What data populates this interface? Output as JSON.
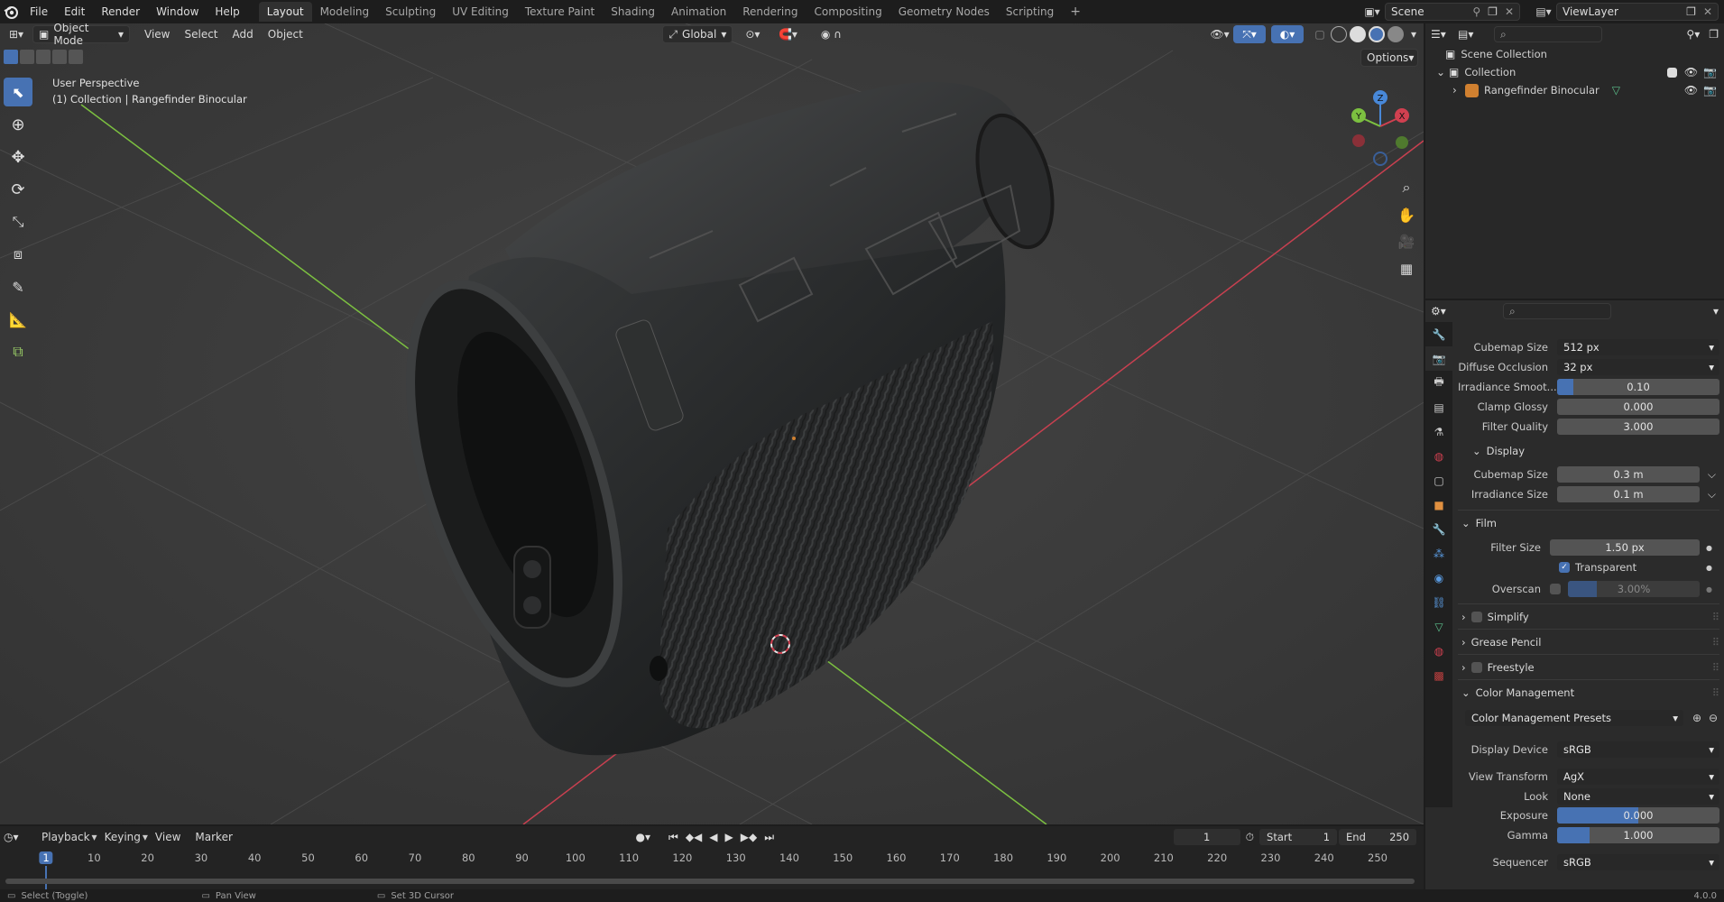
{
  "menu": {
    "items": [
      "File",
      "Edit",
      "Render",
      "Window",
      "Help"
    ]
  },
  "workspaces": [
    "Layout",
    "Modeling",
    "Sculpting",
    "UV Editing",
    "Texture Paint",
    "Shading",
    "Animation",
    "Rendering",
    "Compositing",
    "Geometry Nodes",
    "Scripting"
  ],
  "scene": {
    "name": "Scene",
    "view_layer": "ViewLayer"
  },
  "viewport": {
    "mode": "Object Mode",
    "menus": [
      "View",
      "Select",
      "Add",
      "Object"
    ],
    "transform_orientation": "Global",
    "options_label": "Options",
    "perspective_label": "User Perspective",
    "collection_label": "(1) Collection | Rangefinder Binocular",
    "gizmo_axes": {
      "x": "X",
      "y": "Y",
      "z": "Z"
    }
  },
  "outliner": {
    "root": "Scene Collection",
    "collection": "Collection",
    "object": "Rangefinder Binocular"
  },
  "properties": {
    "rows_top": [
      {
        "label": "Cubemap Size",
        "value": "512 px",
        "type": "dropdown"
      },
      {
        "label": "Diffuse Occlusion",
        "value": "32 px",
        "type": "dropdown"
      },
      {
        "label": "Irradiance Smoot...",
        "value": "0.10",
        "type": "slider",
        "fill": 0.1
      },
      {
        "label": "Clamp Glossy",
        "value": "0.000",
        "type": "number"
      },
      {
        "label": "Filter Quality",
        "value": "3.000",
        "type": "number"
      }
    ],
    "display_section": "Display",
    "display_rows": [
      {
        "label": "Cubemap Size",
        "value": "0.3 m"
      },
      {
        "label": "Irradiance Size",
        "value": "0.1 m"
      }
    ],
    "film_section": "Film",
    "film": {
      "filter_size_label": "Filter Size",
      "filter_size_value": "1.50 px",
      "transparent_label": "Transparent",
      "overscan_label": "Overscan",
      "overscan_value": "3.00%"
    },
    "collapsed_sections": [
      "Simplify",
      "Grease Pencil",
      "Freestyle"
    ],
    "color_management_section": "Color Management",
    "color_presets": "Color Management Presets",
    "color_rows": [
      {
        "label": "Display Device",
        "value": "sRGB",
        "type": "dropdown"
      },
      {
        "label": "View Transform",
        "value": "AgX",
        "type": "dropdown"
      },
      {
        "label": "Look",
        "value": "None",
        "type": "dropdown"
      },
      {
        "label": "Exposure",
        "value": "0.000",
        "type": "slider",
        "fill": 0.5
      },
      {
        "label": "Gamma",
        "value": "1.000",
        "type": "slider",
        "fill": 0.2
      },
      {
        "label": "Sequencer",
        "value": "sRGB",
        "type": "dropdown"
      }
    ]
  },
  "timeline": {
    "menus": [
      "Playback",
      "Keying",
      "View",
      "Marker"
    ],
    "current_frame": "1",
    "start_label": "Start",
    "start_value": "1",
    "end_label": "End",
    "end_value": "250",
    "ticks": [
      "1",
      "10",
      "20",
      "30",
      "40",
      "50",
      "60",
      "70",
      "80",
      "90",
      "100",
      "110",
      "120",
      "130",
      "140",
      "150",
      "160",
      "170",
      "180",
      "190",
      "200",
      "210",
      "220",
      "230",
      "240",
      "250"
    ]
  },
  "status": {
    "select_hint": "Select (Toggle)",
    "pan_hint": "Pan View",
    "cursor_hint": "Set 3D Cursor",
    "version": "4.0.0"
  },
  "colors": {
    "accent": "#4772b3",
    "axis_x": "#d04050",
    "axis_y": "#7cc040",
    "axis_z": "#4888d8"
  }
}
